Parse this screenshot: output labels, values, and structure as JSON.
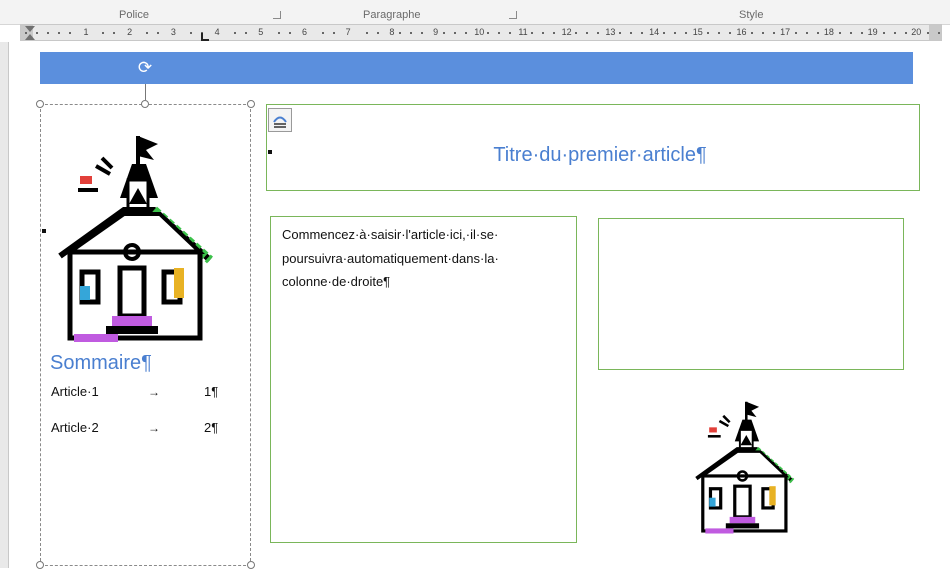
{
  "ribbon": {
    "groups": [
      {
        "label": "Police"
      },
      {
        "label": "Paragraphe"
      },
      {
        "label": "Style"
      }
    ]
  },
  "ruler": {
    "numbers": [
      "1",
      "2",
      "3",
      "4",
      "5",
      "6",
      "7",
      "8",
      "9",
      "10",
      "11",
      "12",
      "13",
      "14",
      "15",
      "16",
      "17",
      "18",
      "19",
      "20"
    ]
  },
  "sidebar": {
    "image": "schoolhouse-clipart",
    "title": "Sommaire¶",
    "toc": [
      {
        "label": "Article·1",
        "arrow": "→",
        "page": "1¶"
      },
      {
        "label": "Article·2",
        "arrow": "→",
        "page": "2¶"
      }
    ]
  },
  "article": {
    "title": "Titre·du·premier·article¶",
    "body_lines": [
      "Commencez·à·saisir·l'article·ici,·il·se·",
      "poursuivra·automatiquement·dans·la·",
      "colonne·de·droite¶"
    ]
  },
  "colors": {
    "banner": "#5b8fdd",
    "heading": "#4a7fd0",
    "frame_border": "#7ab65a"
  },
  "icons": {
    "rotate": "rotate-handle-icon",
    "title_frame": "text-frame-icon",
    "clipart": "schoolhouse-clipart"
  }
}
